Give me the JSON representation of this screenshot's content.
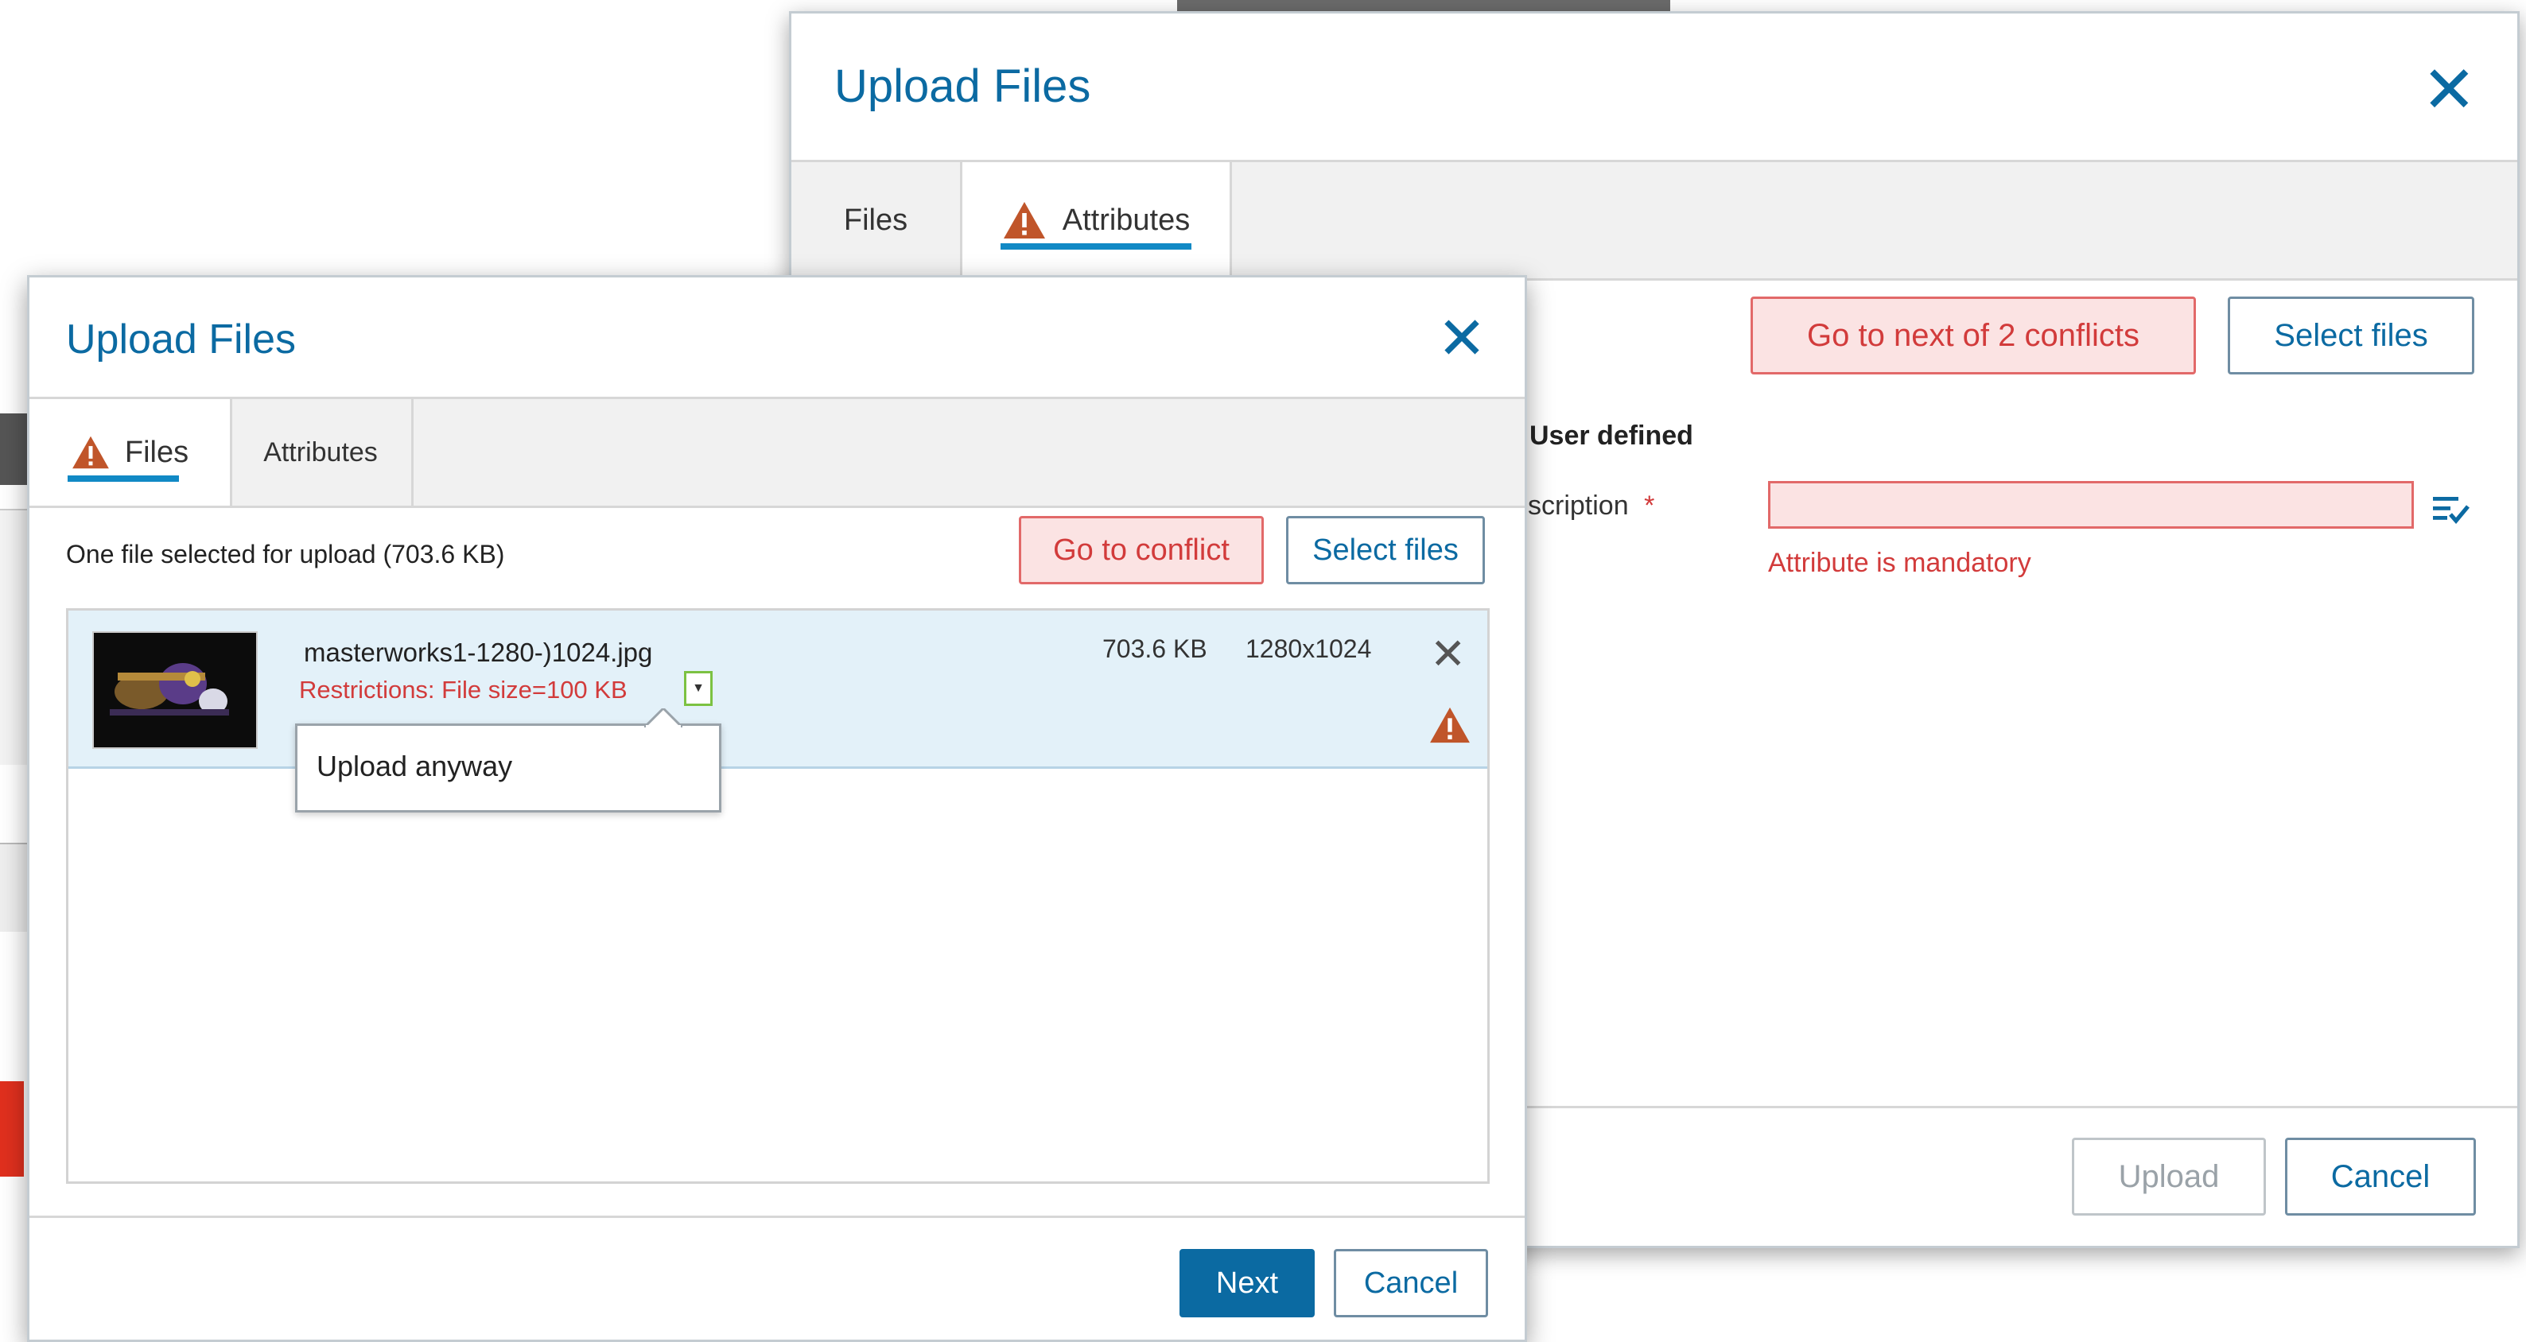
{
  "back_dialog": {
    "title": "Upload Files",
    "tabs": [
      {
        "label": "Files",
        "active": false,
        "warning": false
      },
      {
        "label": "Attributes",
        "active": true,
        "warning": true
      }
    ],
    "conflict_button": "Go to next of 2 conflicts",
    "select_files_button": "Select files",
    "section_heading": "User defined",
    "field_label": "scription",
    "required_marker": "*",
    "field_value": "",
    "field_error": "Attribute is mandatory",
    "upload_button": "Upload",
    "cancel_button": "Cancel"
  },
  "front_dialog": {
    "title": "Upload Files",
    "tabs": [
      {
        "label": "Files",
        "active": true,
        "warning": true
      },
      {
        "label": "Attributes",
        "active": false,
        "warning": false
      }
    ],
    "summary": "One file selected for upload (703.6 KB)",
    "conflict_button": "Go to conflict",
    "select_files_button": "Select files",
    "file": {
      "name": "masterworks1-1280-)1024.jpg",
      "restriction": "Restrictions: File size=100 KB",
      "size": "703.6 KB",
      "dimensions": "1280x1024"
    },
    "dropdown_option": "Upload anyway",
    "next_button": "Next",
    "cancel_button": "Cancel"
  },
  "colors": {
    "accent": "#0b6aa2",
    "tab_underline": "#1189c5",
    "error": "#d23b3b",
    "warning": "#c0552a"
  }
}
